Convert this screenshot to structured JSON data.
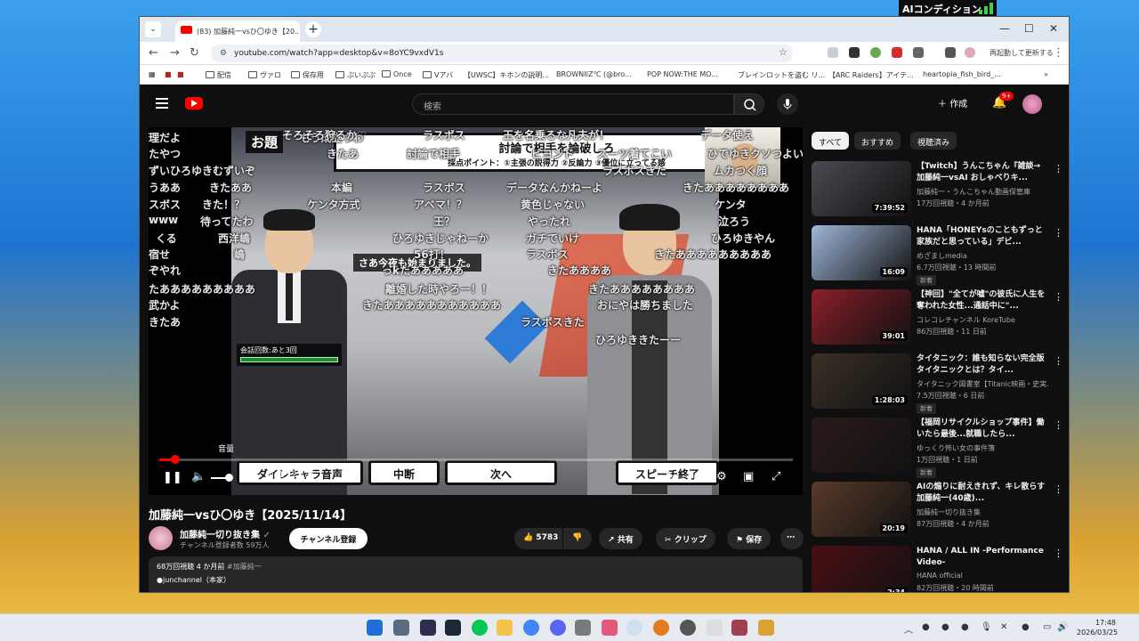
{
  "desktop": {
    "ai_badge": "AIコンディション"
  },
  "browser": {
    "tab_title": "(83) 加藤純一vsひ〇ゆき【20...",
    "url": "youtube.com/watch?app=desktop&v=8oYC9vxdV1s",
    "reload_label": "再起動して更新する",
    "bookmarks": [
      "配信",
      "ヴァロ",
      "保存用",
      "ぷいぷぷ",
      "Once",
      "Vアバ",
      "【UWSC】キホンの説明...",
      "BROWNIIZ℃ (@bro...",
      "POP NOW:THE MO...",
      "ブレインロットを盗む リ...",
      "【ARC Raiders】アイテ...",
      "heartopia_fish_bird_..."
    ]
  },
  "youtube": {
    "search_placeholder": "検索",
    "create_label": "作成",
    "bell_badge": "9+",
    "video": {
      "odai_label": "お題",
      "odai_title": "討論で相手を論破しろ",
      "odai_points": "採点ポイント：①主張の説得力 ②反論力 ③優位に立ってる感",
      "caption": "さあ今夜も始まりました。",
      "counter_label": "会話回数:あと3回",
      "btn_voice": "ダイレキャラ音声",
      "btn_stop": "中断",
      "btn_next": "次へ",
      "btn_speech": "スピーチ終了",
      "volume_tip": "音量",
      "time": "0:41 / 27:35",
      "progress": 0.025,
      "danmaku": [
        "理だよ",
        "もう成立つわ",
        "そろそろ狩るか♡",
        "ラスボス",
        "王を名乗るな凡夫が！",
        "データ使え",
        "たやつ",
        "きたあ",
        "討論で相手",
        "ビヨンド",
        "スーツ着てこい",
        "ひでゆきクソつよい",
        "ずいひろゆきむずいぞ",
        "ラスボスきた",
        "ムカつく顔",
        "うああ",
        "きたああ",
        "本編",
        "ラスボス",
        "データなんかねーよ",
        "きたああああああああ",
        "スボス",
        "きた！？",
        "ケンタ方式",
        "アベマ！？",
        "黄色じゃない",
        "ケンタ",
        "www",
        "待ってたわ",
        "王？",
        "やったれ",
        "泣ろう",
        "くる",
        "西洋嶋",
        "ひろゆきじゃねーか",
        "ガチでいけ",
        "ひろゆきやん",
        "宿せ",
        "嶋",
        "56打！",
        "ラスボス",
        "きたあああああああああ",
        "ぞやれ",
        "っkたあああああ",
        "きたああああ",
        "たあああああああああ",
        "離婚した時やろー！！",
        "きたああああああああ",
        "武かよ",
        "きたあああああああああああ",
        "おにやは勝ちました",
        "きたあ",
        "ラスボスきた",
        "ひろゆききたーー"
      ]
    },
    "title": "加藤純一vsひ〇ゆき【2025/11/14】",
    "channel": {
      "name": "加藤純一切り抜き集",
      "subs": "チャンネル登録者数 59万人",
      "subscribe": "チャンネル登録"
    },
    "actions": {
      "likes": "5783",
      "share": "共有",
      "clip": "クリップ",
      "save": "保存"
    },
    "description": {
      "stats": "68万回視聴  4 か月前",
      "hashtag": "#加藤純一",
      "line2": "●junchannel（本家）"
    },
    "chips": [
      "すべて",
      "おすすめ",
      "視聴済み"
    ],
    "recommendations": [
      {
        "title": "【Twitch】うんこちゃん『雑談→加藤純一vsAI おしゃべりキ...",
        "channel": "加藤純一・うんこちゃん動画保管庫",
        "meta": "17万回視聴・4 か月前",
        "duration": "7:39:52",
        "new": "",
        "color": "#4a4a52"
      },
      {
        "title": "HANA「HONEYsのこともずっと家族だと思っている」デビ...",
        "channel": "めざましmedia",
        "meta": "6.7万回視聴・13 時間前",
        "duration": "16:09",
        "new": "新着",
        "color": "#9fb7d8"
      },
      {
        "title": "【神回】\"全てが嘘\"の彼氏に人生を奪われた女性...通話中に\"...",
        "channel": "コレコレチャンネル KoreTube",
        "meta": "86万回視聴・11 日前",
        "duration": "39:01",
        "new": "",
        "color": "#8a1f2a"
      },
      {
        "title": "タイタニック：誰も知らない完全版タイタニックとは？タイ...",
        "channel": "タイタニック図書室【Titanic映画・史実...",
        "meta": "7.5万回視聴・6 日前",
        "duration": "1:28:03",
        "new": "新着",
        "color": "#3a3026"
      },
      {
        "title": "【福岡リサイクルショップ事件】働いたら最後...就職したら...",
        "channel": "ゆっくり怖い女の事件簿",
        "meta": "1万回視聴・1 日前",
        "duration": "",
        "new": "新着",
        "color": "#2b1a1a"
      },
      {
        "title": "AIの煽りに耐えきれず、キレ散らす加藤純一(40歳)...",
        "channel": "加藤純一切り抜き集",
        "meta": "87万回視聴・4 か月前",
        "duration": "20:19",
        "new": "",
        "color": "#5a3b2a"
      },
      {
        "title": "HANA / ALL IN -Performance Video-",
        "channel": "HANA official",
        "meta": "82万回視聴・20 時間前",
        "duration": "2:34",
        "new": "新着",
        "color": "#4a0f14"
      }
    ]
  },
  "taskbar": {
    "time": "17:48",
    "date": "2026/03/25"
  }
}
